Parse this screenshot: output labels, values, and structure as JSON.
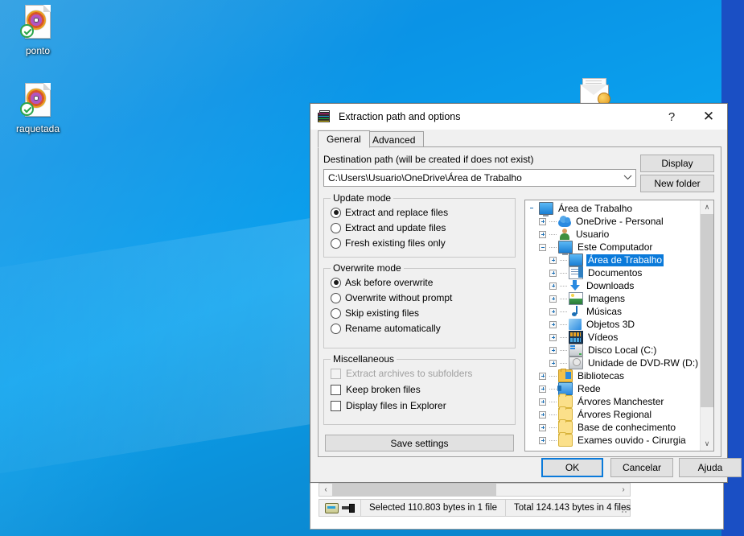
{
  "desktop": {
    "icons": [
      {
        "name": "ponto",
        "label": "ponto",
        "type": "media-file"
      },
      {
        "name": "raquetada",
        "label": "raquetada",
        "type": "media-file"
      },
      {
        "name": "mail",
        "label": "",
        "type": "envelope"
      }
    ]
  },
  "background_window": {
    "status": {
      "selected": "Selected 110.803 bytes in 1 file",
      "total": "Total 124.143 bytes in 4 files"
    },
    "hscroll": {
      "left": "‹",
      "right": "›"
    }
  },
  "dialog": {
    "title": "Extraction path and options",
    "icon": "winrar-books-icon",
    "help_glyph": "?",
    "close_glyph": "✕",
    "tabs": [
      {
        "label": "General",
        "active": true
      },
      {
        "label": "Advanced",
        "active": false
      }
    ],
    "destination": {
      "label": "Destination path (will be created if does not exist)",
      "value": "C:\\Users\\Usuario\\OneDrive\\Área de Trabalho",
      "chevron": "⌵"
    },
    "side_buttons": {
      "display": "Display",
      "new_folder": "New folder"
    },
    "update_mode": {
      "title": "Update mode",
      "options": [
        {
          "label": "Extract and replace files",
          "selected": true
        },
        {
          "label": "Extract and update files",
          "selected": false
        },
        {
          "label": "Fresh existing files only",
          "selected": false
        }
      ]
    },
    "overwrite_mode": {
      "title": "Overwrite mode",
      "options": [
        {
          "label": "Ask before overwrite",
          "selected": true
        },
        {
          "label": "Overwrite without prompt",
          "selected": false
        },
        {
          "label": "Skip existing files",
          "selected": false
        },
        {
          "label": "Rename automatically",
          "selected": false
        }
      ]
    },
    "miscellaneous": {
      "title": "Miscellaneous",
      "options": [
        {
          "label": "Extract archives to subfolders",
          "checked": false,
          "disabled": true
        },
        {
          "label": "Keep broken files",
          "checked": false,
          "disabled": false
        },
        {
          "label": "Display files in Explorer",
          "checked": false,
          "disabled": false
        }
      ]
    },
    "save_settings": "Save settings",
    "footer": {
      "ok": "OK",
      "cancel": "Cancelar",
      "help": "Ajuda"
    },
    "tree": {
      "scroll_up": "∧",
      "scroll_down": "∨",
      "nodes": [
        {
          "label": "Área de Trabalho",
          "indent": 0,
          "expander": "none",
          "icon": "monitor-icon",
          "selected": false
        },
        {
          "label": "OneDrive - Personal",
          "indent": 1,
          "expander": "plus",
          "icon": "cloud-icon",
          "selected": false
        },
        {
          "label": "Usuario",
          "indent": 1,
          "expander": "plus",
          "icon": "user-icon",
          "selected": false
        },
        {
          "label": "Este Computador",
          "indent": 1,
          "expander": "minus",
          "icon": "monitor-icon",
          "selected": false
        },
        {
          "label": "Área de Trabalho",
          "indent": 2,
          "expander": "plus",
          "icon": "monitor-icon",
          "selected": true
        },
        {
          "label": "Documentos",
          "indent": 2,
          "expander": "plus",
          "icon": "document-icon",
          "selected": false
        },
        {
          "label": "Downloads",
          "indent": 2,
          "expander": "plus",
          "icon": "download-icon",
          "selected": false
        },
        {
          "label": "Imagens",
          "indent": 2,
          "expander": "plus",
          "icon": "picture-icon",
          "selected": false
        },
        {
          "label": "Músicas",
          "indent": 2,
          "expander": "plus",
          "icon": "music-icon",
          "selected": false
        },
        {
          "label": "Objetos 3D",
          "indent": 2,
          "expander": "plus",
          "icon": "cube-icon",
          "selected": false
        },
        {
          "label": "Vídeos",
          "indent": 2,
          "expander": "plus",
          "icon": "video-icon",
          "selected": false
        },
        {
          "label": "Disco Local (C:)",
          "indent": 2,
          "expander": "plus",
          "icon": "harddisk-icon",
          "selected": false
        },
        {
          "label": "Unidade de DVD-RW (D:)",
          "indent": 2,
          "expander": "plus",
          "icon": "dvd-icon",
          "selected": false
        },
        {
          "label": "Bibliotecas",
          "indent": 1,
          "expander": "plus",
          "icon": "library-icon",
          "selected": false
        },
        {
          "label": "Rede",
          "indent": 1,
          "expander": "plus",
          "icon": "network-icon",
          "selected": false
        },
        {
          "label": "Árvores Manchester",
          "indent": 1,
          "expander": "plus",
          "icon": "folder-icon",
          "selected": false
        },
        {
          "label": "Árvores Regional",
          "indent": 1,
          "expander": "plus",
          "icon": "folder-icon",
          "selected": false
        },
        {
          "label": "Base de conhecimento",
          "indent": 1,
          "expander": "plus",
          "icon": "folder-icon",
          "selected": false
        },
        {
          "label": "Exames ouvido - Cirurgia",
          "indent": 1,
          "expander": "plus",
          "icon": "folder-icon",
          "selected": false
        }
      ]
    }
  },
  "colors": {
    "accent": "#0a7ada",
    "dialog_bg": "#f0f0f0",
    "desktop_blue": "#0a93e6"
  }
}
